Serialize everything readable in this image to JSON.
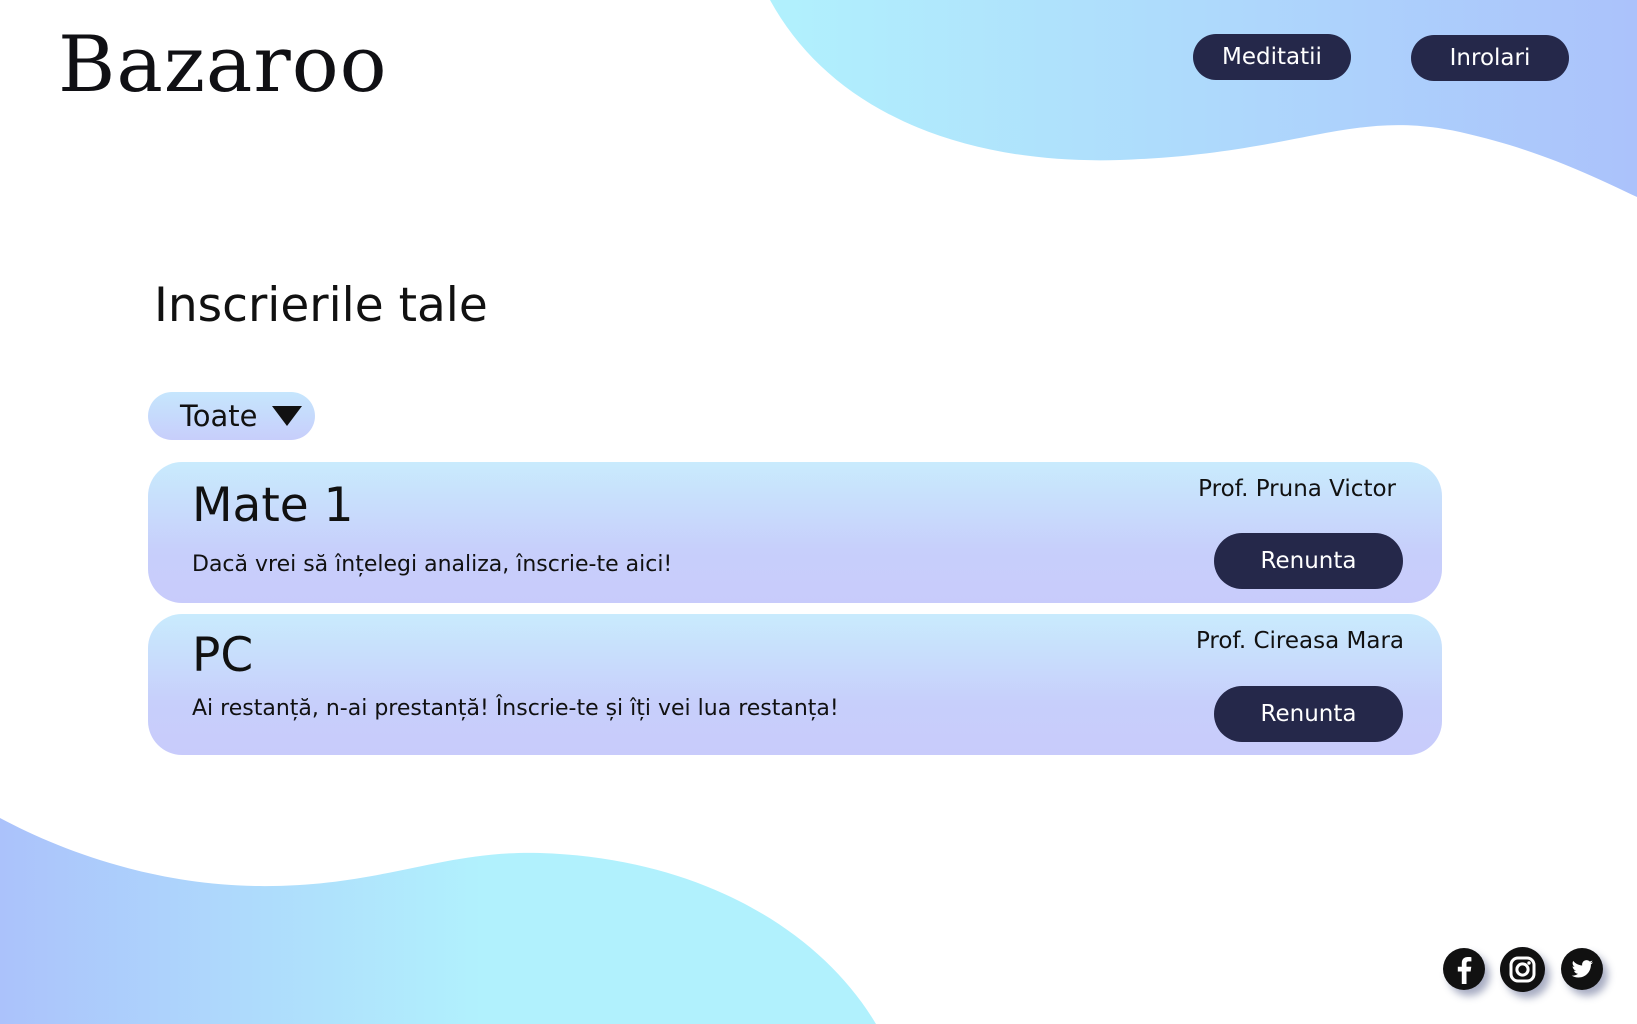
{
  "brand": {
    "logo_text": "Bazaroo"
  },
  "nav": {
    "meditatii_label": "Meditatii",
    "inrolari_label": "Inrolari"
  },
  "main": {
    "title": "Inscrierile tale",
    "filter": {
      "selected": "Toate"
    },
    "courses": [
      {
        "title": "Mate 1",
        "description": "Dacă vrei să înțelegi analiza, înscrie-te aici!",
        "professor": "Prof. Pruna Victor",
        "action_label": "Renunta"
      },
      {
        "title": "PC",
        "description": "Ai restanță, n-ai prestanță! Înscrie-te și îți vei lua restanța!",
        "professor": "Prof. Cireasa Mara",
        "action_label": "Renunta"
      }
    ]
  },
  "footer": {
    "social": [
      "facebook-icon",
      "instagram-icon",
      "twitter-icon"
    ]
  },
  "colors": {
    "primary_dark": "#25284a",
    "gradient_cyan": "#b1f1fd",
    "gradient_periwinkle": "#abc2fb",
    "card_top": "#c9ebfd",
    "card_bottom": "#c8cbfb"
  }
}
